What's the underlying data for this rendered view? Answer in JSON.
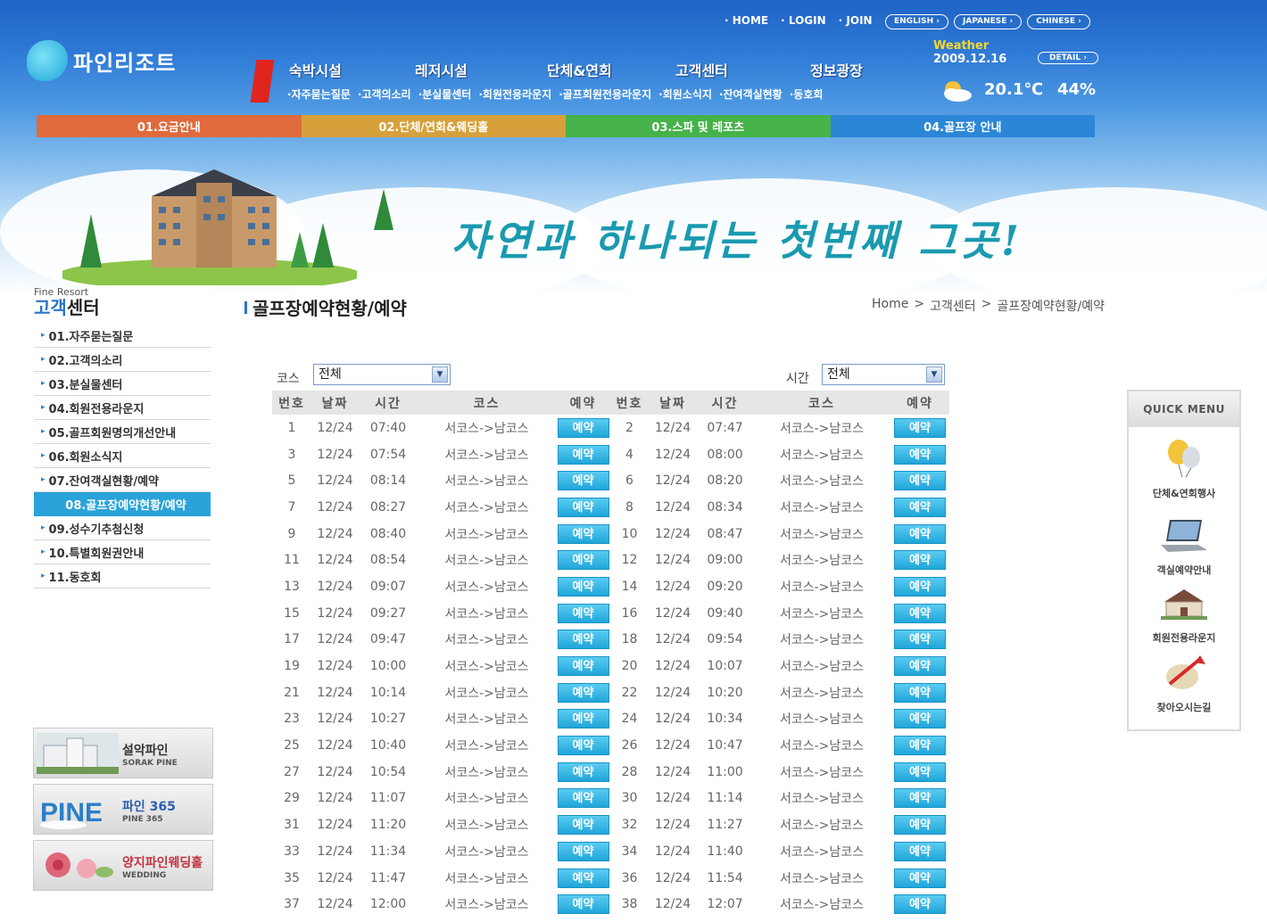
{
  "header": {
    "logo_text": "파인리조트",
    "top_links": [
      "HOME",
      "LOGIN",
      "JOIN"
    ],
    "lang_buttons": [
      "ENGLISH ›",
      "JAPANESE ›",
      "CHINESE ›"
    ],
    "nav_badge": "4",
    "main_nav": [
      "숙박시설",
      "레저시설",
      "단체&연회",
      "고객센터",
      "정보광장"
    ],
    "sub_nav": [
      "자주묻는질문",
      "고객의소리",
      "분실물센터",
      "회원전용라운지",
      "골프회원전용라운지",
      "회원소식지",
      "잔여객실현황",
      "동호회"
    ],
    "weather": {
      "label": "Weather",
      "date": "2009.12.16",
      "detail_label": "DETAIL ›",
      "temperature": "20.1℃",
      "humidity": "44%"
    },
    "color_bar": [
      {
        "label": "01.요금안내",
        "color": "#e06a3c"
      },
      {
        "label": "02.단체/연회&웨딩홀",
        "color": "#d6a13a"
      },
      {
        "label": "03.스파 및 레포츠",
        "color": "#46b24a"
      },
      {
        "label": "04.골프장 안내",
        "color": "#2c86d8"
      }
    ],
    "slogan": "자연과 하나되는 첫번째 그곳!"
  },
  "left": {
    "title_small": "Fine Resort",
    "title_big_hl": "고객",
    "title_big": "센터",
    "menu": [
      "01.자주묻는질문",
      "02.고객의소리",
      "03.분실물센터",
      "04.회원전용라운지",
      "05.골프회원명의개선안내",
      "06.회원소식지",
      "07.잔여객실현황/예약",
      "08.골프장예약현황/예약",
      "09.성수기추첨신청",
      "10.특별회원권안내",
      "11.동호회"
    ],
    "active_index": 7,
    "banners": [
      {
        "title": "설악파인",
        "subtitle": "SORAK PINE"
      },
      {
        "title": "파인 365",
        "subtitle": "PINE 365"
      },
      {
        "title": "양지파인웨딩홀",
        "subtitle": "WEDDING"
      }
    ]
  },
  "content": {
    "page_title": "골프장예약현황/예약",
    "breadcrumb": [
      "Home",
      ">",
      "고객센터",
      ">",
      "골프장예약현황/예약"
    ],
    "filters": {
      "course_label": "코스",
      "course_value": "전체",
      "time_label": "시간",
      "time_value": "전체"
    },
    "columns": [
      "번호",
      "날짜",
      "시간",
      "코스",
      "예약",
      "번호",
      "날짜",
      "시간",
      "코스",
      "예약"
    ],
    "reserve_label": "예약",
    "course_text": "서코스->남코스",
    "date": "12/24",
    "rows": [
      [
        "1",
        "07:40",
        "2",
        "07:47"
      ],
      [
        "3",
        "07:54",
        "4",
        "08:00"
      ],
      [
        "5",
        "08:14",
        "6",
        "08:20"
      ],
      [
        "7",
        "08:27",
        "8",
        "08:34"
      ],
      [
        "9",
        "08:40",
        "10",
        "08:47"
      ],
      [
        "11",
        "08:54",
        "12",
        "09:00"
      ],
      [
        "13",
        "09:07",
        "14",
        "09:20"
      ],
      [
        "15",
        "09:27",
        "16",
        "09:40"
      ],
      [
        "17",
        "09:47",
        "18",
        "09:54"
      ],
      [
        "19",
        "10:00",
        "20",
        "10:07"
      ],
      [
        "21",
        "10:14",
        "22",
        "10:20"
      ],
      [
        "23",
        "10:27",
        "24",
        "10:34"
      ],
      [
        "25",
        "10:40",
        "26",
        "10:47"
      ],
      [
        "27",
        "10:54",
        "28",
        "11:00"
      ],
      [
        "29",
        "11:07",
        "30",
        "11:14"
      ],
      [
        "31",
        "11:20",
        "32",
        "11:27"
      ],
      [
        "33",
        "11:34",
        "34",
        "11:40"
      ],
      [
        "35",
        "11:47",
        "36",
        "11:54"
      ],
      [
        "37",
        "12:00",
        "38",
        "12:07"
      ]
    ]
  },
  "quick_menu": {
    "title": "QUICK MENU",
    "items": [
      "단체&연회행사",
      "객실예약안내",
      "회원전용라운지",
      "찾아오시는길"
    ]
  }
}
